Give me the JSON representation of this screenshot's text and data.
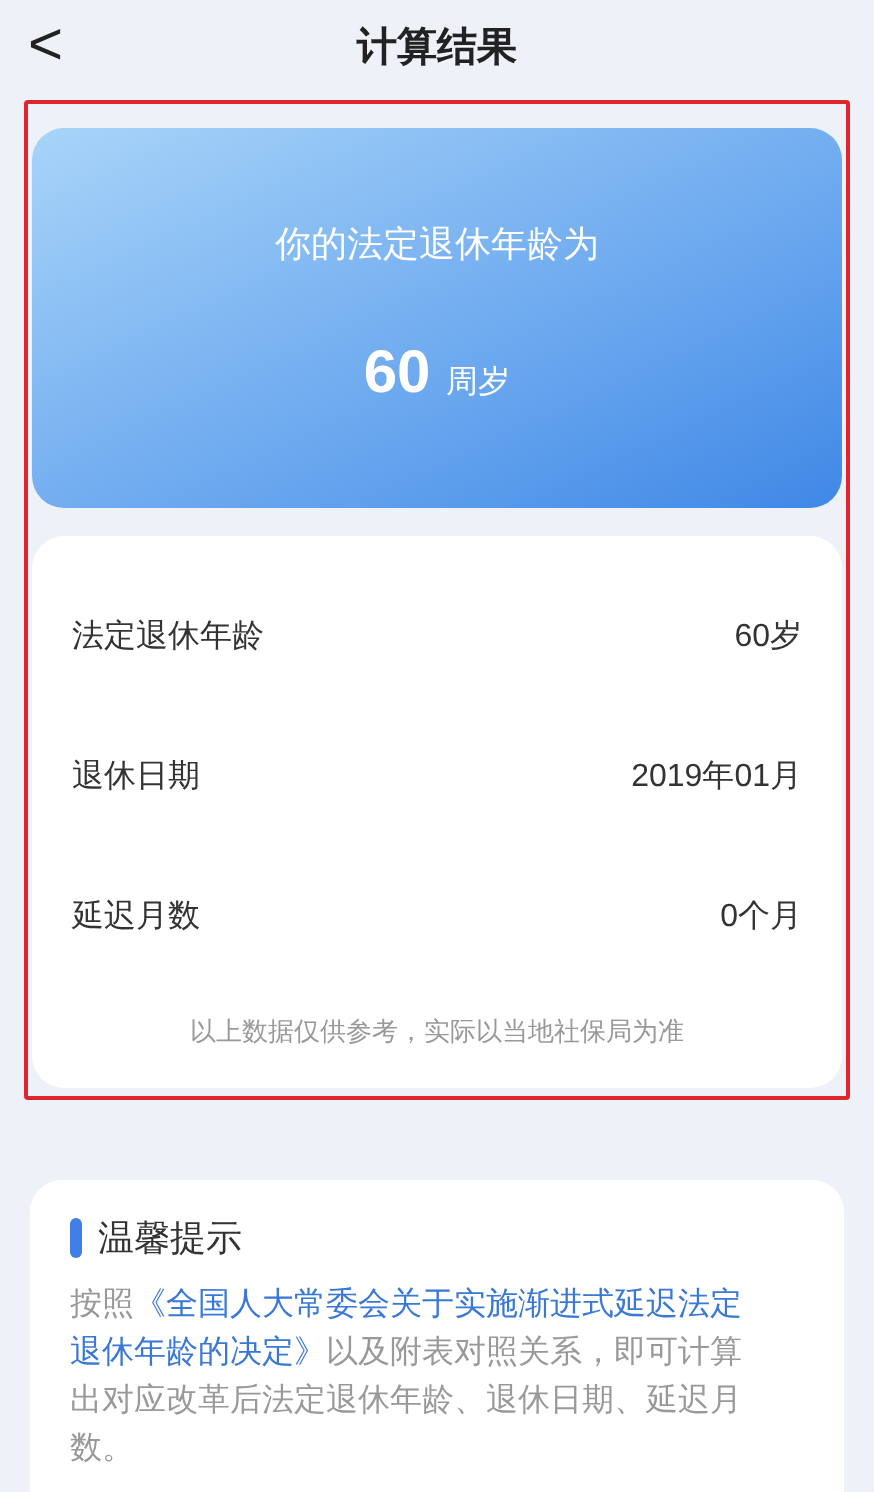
{
  "header": {
    "back": "<",
    "title": "计算结果"
  },
  "result": {
    "caption": "你的法定退休年龄为",
    "age": "60",
    "unit": "周岁"
  },
  "details": [
    {
      "label": "法定退休年龄",
      "value": "60岁"
    },
    {
      "label": "退休日期",
      "value": "2019年01月"
    },
    {
      "label": "延迟月数",
      "value": "0个月"
    }
  ],
  "note": "以上数据仅供参考，实际以当地社保局为准",
  "tip": {
    "title": "温馨提示",
    "prefix": "按照",
    "link_lines": [
      "《全国人大常委会关于实施渐进式延迟法定",
      "退休年龄的决定》"
    ],
    "suffix_lines": [
      "以及附表对照关系，即可计算",
      "出对应改革后法定退休年龄、退休日期、延迟月",
      "数。"
    ]
  }
}
